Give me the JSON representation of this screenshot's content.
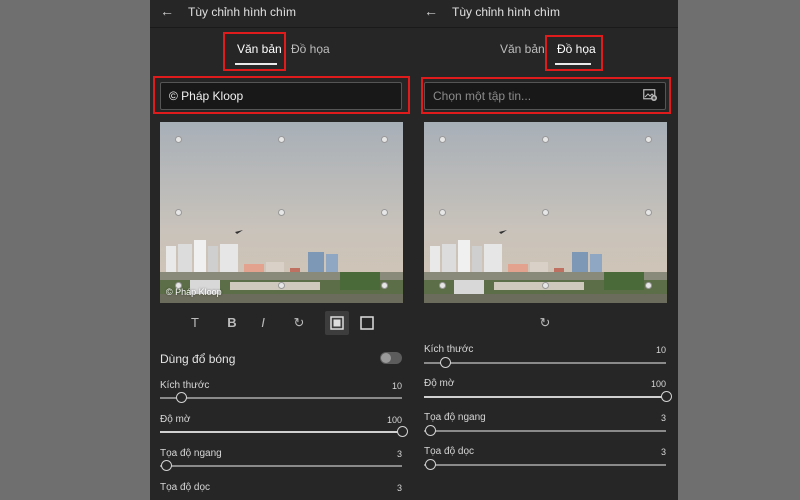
{
  "left_panel": {
    "back_icon": "arrow-left-icon",
    "title": "Tùy chỉnh hình chìm",
    "tabs": [
      {
        "label": "Văn bản",
        "active": true
      },
      {
        "label": "Đồ họa",
        "active": false
      }
    ],
    "text_input": {
      "value": "© Pháp Kloop"
    },
    "preview_watermark_text": "© Pháp Kloop",
    "toolbar": [
      "text-icon",
      "bold-icon",
      "italic-icon",
      "rotate-icon",
      "filled-square-icon",
      "outline-square-icon"
    ],
    "toolbar_glyphs": {
      "text": "T",
      "bold": "B",
      "italic": "I",
      "rotate": "↻"
    },
    "shadow": {
      "label": "Dùng đổ bóng",
      "enabled": false
    },
    "sliders": [
      {
        "label": "Kích thước",
        "value": "10",
        "fraction": 0.1
      },
      {
        "label": "Độ mờ",
        "value": "100",
        "fraction": 1.0
      },
      {
        "label": "Tọa độ ngang",
        "value": "3",
        "fraction": 0.03
      },
      {
        "label": "Tọa độ dọc",
        "value": "3",
        "fraction": 0.03
      }
    ]
  },
  "right_panel": {
    "back_icon": "arrow-left-icon",
    "title": "Tùy chỉnh hình chìm",
    "tabs": [
      {
        "label": "Văn bản",
        "active": false
      },
      {
        "label": "Đồ họa",
        "active": true
      }
    ],
    "file_input": {
      "placeholder": "Chọn một tập tin...",
      "icon": "add-image-icon"
    },
    "toolbar": [
      "rotate-icon"
    ],
    "toolbar_glyphs": {
      "rotate": "↻"
    },
    "sliders": [
      {
        "label": "Kích thước",
        "value": "10",
        "fraction": 0.1
      },
      {
        "label": "Độ mờ",
        "value": "100",
        "fraction": 1.0
      },
      {
        "label": "Tọa độ ngang",
        "value": "3",
        "fraction": 0.03
      },
      {
        "label": "Tọa độ dọc",
        "value": "3",
        "fraction": 0.03
      }
    ]
  },
  "colors": {
    "highlight": "#e01b1b",
    "panel_bg": "#262626",
    "page_bg": "#6f6f6f"
  }
}
